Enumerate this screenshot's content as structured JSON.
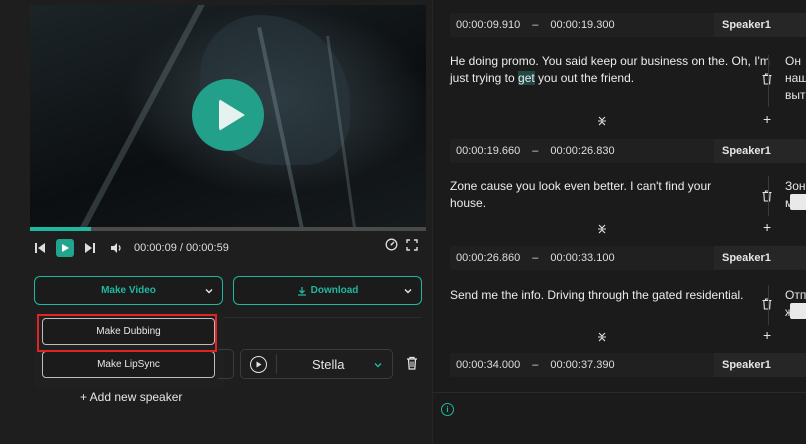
{
  "player": {
    "current_time": "00:00:09",
    "duration": "00:00:59",
    "progress_fraction": 0.155
  },
  "actions": {
    "make_video": "Make Video",
    "download": "Download"
  },
  "menu": {
    "make_dubbing": "Make Dubbing",
    "make_lipsync": "Make LipSync"
  },
  "speaker_row": {
    "voice": "Stella"
  },
  "add_speaker": "+ Add new speaker",
  "segments": [
    {
      "start": "00:00:09.910",
      "end": "00:00:19.300",
      "speaker": "Speaker1",
      "text_a": "He doing promo. You said keep our business on the. Oh, I'm just trying to ",
      "text_hl": "get",
      "text_b": " you out the friend.",
      "translation": "Он\nнаш\nвыт"
    },
    {
      "start": "00:00:19.660",
      "end": "00:00:26.830",
      "speaker": "Speaker1",
      "text_a": "Zone cause you look even better. I can't find your house.",
      "text_hl": "",
      "text_b": "",
      "translation": "Зон\nмог"
    },
    {
      "start": "00:00:26.860",
      "end": "00:00:33.100",
      "speaker": "Speaker1",
      "text_a": "Send me the info. Driving through the gated residential.",
      "text_hl": "",
      "text_b": "",
      "translation": "Отп\nжил"
    },
    {
      "start": "00:00:34.000",
      "end": "00:00:37.390",
      "speaker": "Speaker1"
    }
  ],
  "colors": {
    "accent": "#1fb89f",
    "highlight_box": "#e02424"
  }
}
